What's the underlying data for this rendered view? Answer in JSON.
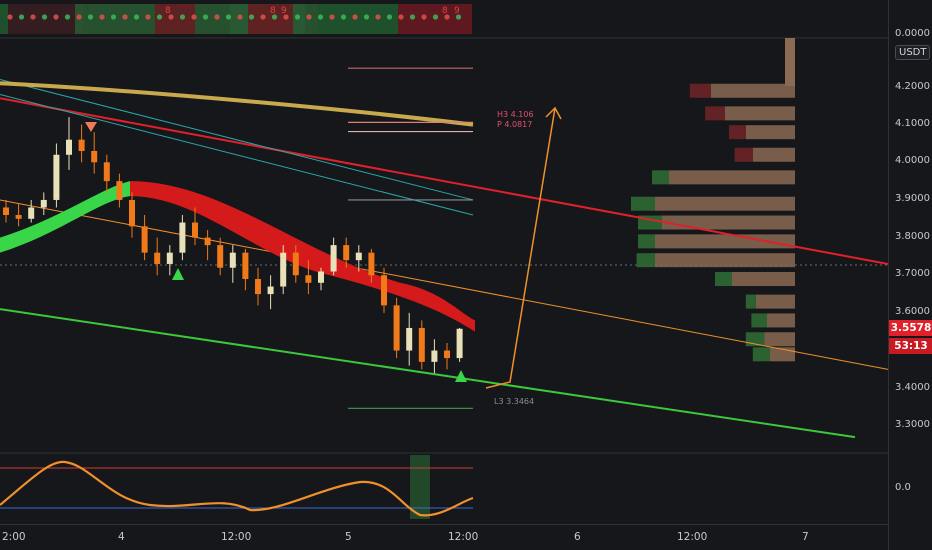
{
  "price_axis": {
    "currency": "USDT",
    "ticks": [
      "4.2000",
      "4.1000",
      "4.0000",
      "3.9000",
      "3.8000",
      "3.7000",
      "3.6000",
      "3.4000",
      "3.3000"
    ],
    "top_tick": "0.0000",
    "osc_tick": "0.0",
    "last_price": "3.5578",
    "countdown": "53:13"
  },
  "time_axis": {
    "ticks": [
      "2:00",
      "4",
      "12:00",
      "5",
      "12:00",
      "6",
      "12:00",
      "7"
    ]
  },
  "annotations": {
    "h3": "H3 4.106",
    "p": "P 4.0817",
    "l3": "L3 3.3464"
  },
  "indicator_digits": [
    "8",
    "8",
    "9",
    "8",
    "9"
  ],
  "colors": {
    "up": "#e8e0b8",
    "down": "#f07a1a",
    "ribbon_bear": "#d41a1a",
    "ribbon_bull": "#3ad64a",
    "accent_red": "#e0202a",
    "support": "#3cc83c",
    "ma": "#c9a94e",
    "orange": "#f0902a"
  },
  "chart_data": {
    "type": "line",
    "pivots": {
      "H3": 4.106,
      "P": 4.0817,
      "L3": 3.3464
    },
    "last_price": 3.5578,
    "y_ticks": [
      4.2,
      4.1,
      4.0,
      3.9,
      3.8,
      3.7,
      3.6,
      3.4,
      3.3
    ],
    "x_ticks": [
      "2:00",
      "4",
      "12:00",
      "5",
      "12:00",
      "6",
      "12:00",
      "7"
    ],
    "candles": [
      [
        3.88,
        3.9,
        3.84,
        3.86
      ],
      [
        3.86,
        3.89,
        3.83,
        3.85
      ],
      [
        3.85,
        3.9,
        3.84,
        3.88
      ],
      [
        3.88,
        3.92,
        3.86,
        3.9
      ],
      [
        3.9,
        4.05,
        3.88,
        4.02
      ],
      [
        4.02,
        4.12,
        3.98,
        4.06
      ],
      [
        4.06,
        4.1,
        4.0,
        4.03
      ],
      [
        4.03,
        4.08,
        3.97,
        4.0
      ],
      [
        4.0,
        4.02,
        3.92,
        3.95
      ],
      [
        3.95,
        3.97,
        3.88,
        3.9
      ],
      [
        3.9,
        3.92,
        3.8,
        3.83
      ],
      [
        3.83,
        3.86,
        3.74,
        3.76
      ],
      [
        3.76,
        3.8,
        3.7,
        3.73
      ],
      [
        3.73,
        3.78,
        3.7,
        3.76
      ],
      [
        3.76,
        3.86,
        3.74,
        3.84
      ],
      [
        3.84,
        3.88,
        3.78,
        3.8
      ],
      [
        3.8,
        3.82,
        3.74,
        3.78
      ],
      [
        3.78,
        3.8,
        3.7,
        3.72
      ],
      [
        3.72,
        3.78,
        3.68,
        3.76
      ],
      [
        3.76,
        3.77,
        3.66,
        3.69
      ],
      [
        3.69,
        3.72,
        3.62,
        3.65
      ],
      [
        3.65,
        3.7,
        3.61,
        3.67
      ],
      [
        3.67,
        3.78,
        3.65,
        3.76
      ],
      [
        3.76,
        3.78,
        3.68,
        3.7
      ],
      [
        3.7,
        3.74,
        3.65,
        3.68
      ],
      [
        3.68,
        3.72,
        3.66,
        3.71
      ],
      [
        3.71,
        3.8,
        3.7,
        3.78
      ],
      [
        3.78,
        3.8,
        3.72,
        3.74
      ],
      [
        3.74,
        3.78,
        3.71,
        3.76
      ],
      [
        3.76,
        3.77,
        3.68,
        3.7
      ],
      [
        3.7,
        3.72,
        3.6,
        3.62
      ],
      [
        3.62,
        3.64,
        3.48,
        3.5
      ],
      [
        3.5,
        3.6,
        3.46,
        3.56
      ],
      [
        3.56,
        3.58,
        3.45,
        3.47
      ],
      [
        3.47,
        3.53,
        3.44,
        3.5
      ],
      [
        3.5,
        3.52,
        3.45,
        3.48
      ],
      [
        3.48,
        3.56,
        3.47,
        3.5578
      ]
    ],
    "volume_profile": [
      [
        4.19,
        0.08,
        0.6
      ],
      [
        4.13,
        0.07,
        0.5
      ],
      [
        4.08,
        0.05,
        0.35
      ],
      [
        4.02,
        0.06,
        0.3
      ],
      [
        3.96,
        0.05,
        0.9
      ],
      [
        3.89,
        0.1,
        1.0
      ],
      [
        3.84,
        0.1,
        0.95
      ],
      [
        3.79,
        0.05,
        1.0
      ],
      [
        3.74,
        0.06,
        1.0
      ],
      [
        3.69,
        0.05,
        0.45
      ],
      [
        3.63,
        0.0,
        0.28
      ],
      [
        3.58,
        0.04,
        0.2
      ],
      [
        3.53,
        0.06,
        0.22
      ],
      [
        3.49,
        0.05,
        0.18
      ]
    ]
  }
}
